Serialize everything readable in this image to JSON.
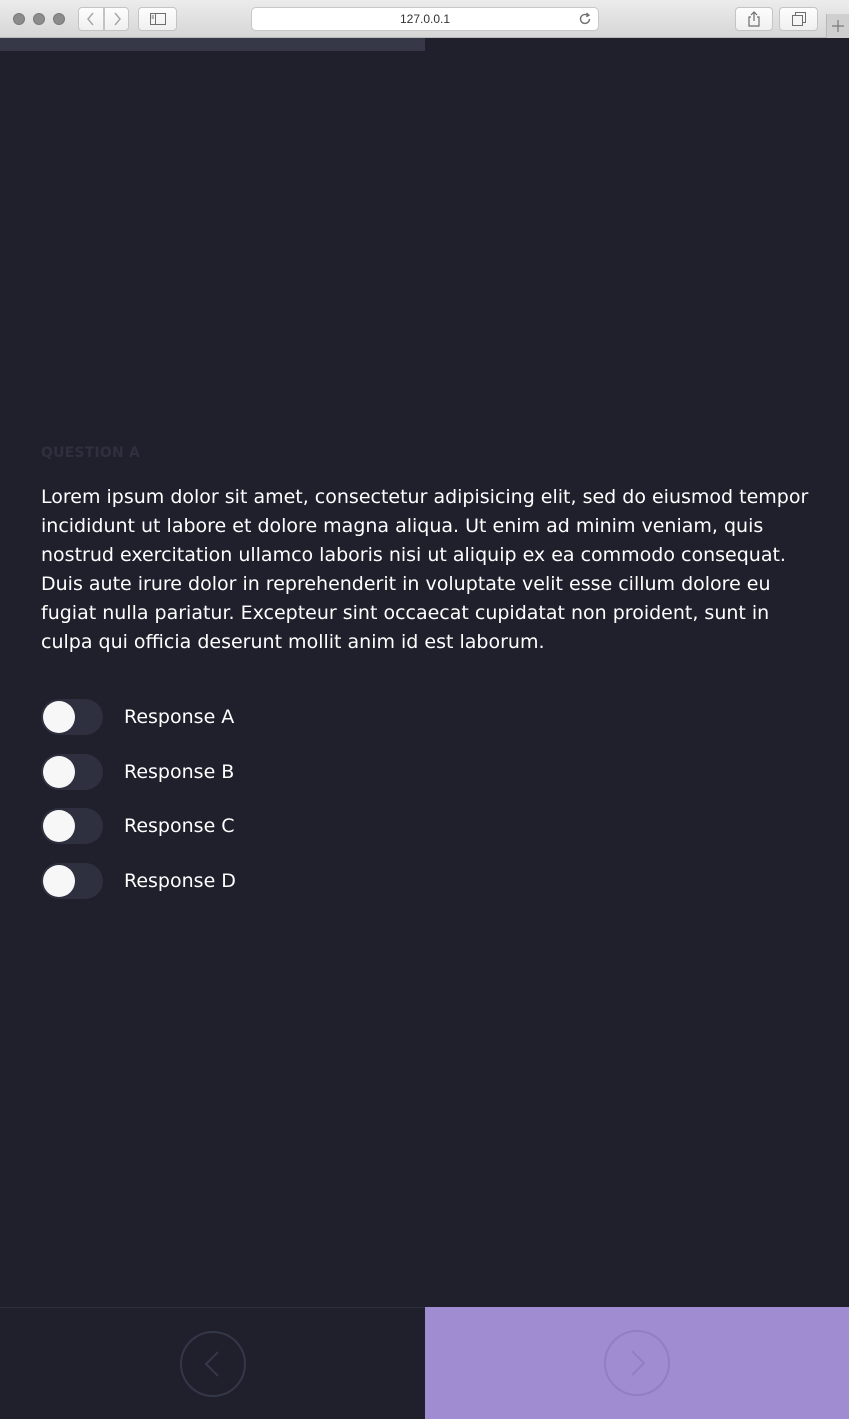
{
  "browser": {
    "url": "127.0.0.1"
  },
  "progress": {
    "fraction": 0.5
  },
  "question": {
    "label": "QUESTION A",
    "text": "Lorem ipsum dolor sit amet, consectetur adipisicing elit, sed do eiusmod tempor incididunt ut labore et dolore magna aliqua. Ut enim ad minim veniam, quis nostrud exercitation ullamco laboris nisi ut aliquip ex ea commodo consequat. Duis aute irure dolor in reprehenderit in voluptate velit esse cillum dolore eu fugiat nulla pariatur. Excepteur sint occaecat cupidatat non proident, sunt in culpa qui officia deserunt mollit anim id est laborum."
  },
  "responses": [
    {
      "label": "Response A",
      "checked": false
    },
    {
      "label": "Response B",
      "checked": false
    },
    {
      "label": "Response C",
      "checked": false
    },
    {
      "label": "Response D",
      "checked": false
    }
  ],
  "nav": {
    "prev_icon": "chevron-left-icon",
    "next_icon": "chevron-right-icon"
  },
  "colors": {
    "background": "#1f202c",
    "accent": "#a08cd1",
    "toggle_track": "#2e303f",
    "knob": "#f7f7f8"
  }
}
